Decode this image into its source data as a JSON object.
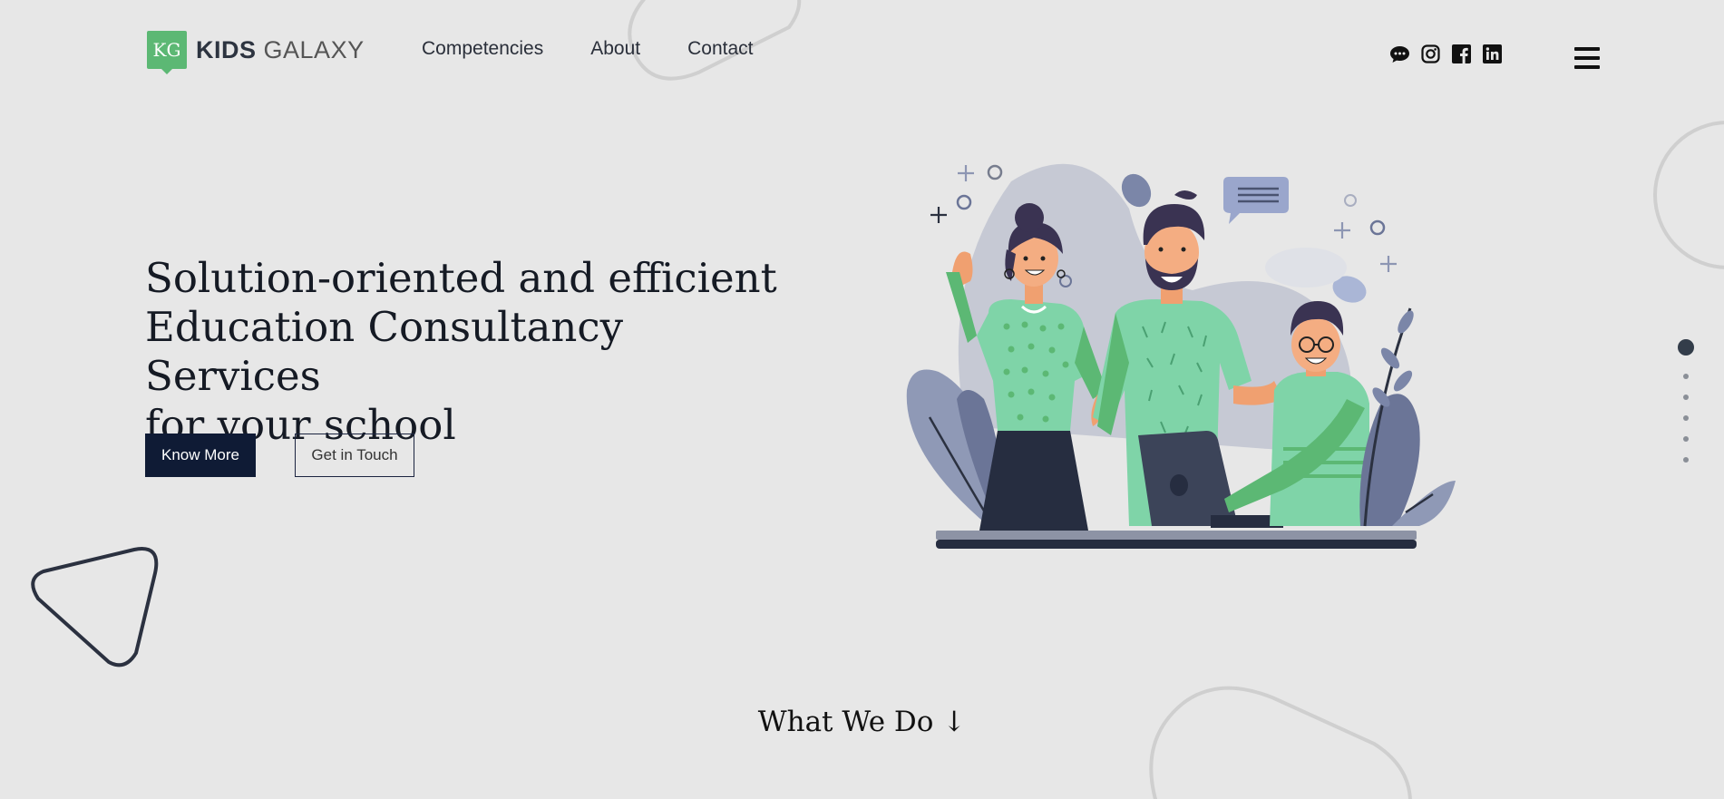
{
  "header": {
    "logo_badge": "KG",
    "logo_bold": "KIDS",
    "logo_light": "GALAXY",
    "nav": [
      {
        "label": "Competencies"
      },
      {
        "label": "About"
      },
      {
        "label": "Contact"
      }
    ],
    "socials": [
      "chat-icon",
      "instagram-icon",
      "facebook-icon",
      "linkedin-icon"
    ],
    "menu_icon": "hamburger-menu-icon"
  },
  "hero": {
    "title_lines": [
      "Solution-oriented and efficient",
      "Education Consultancy Services",
      "for your school"
    ],
    "primary_button": "Know More",
    "secondary_button": "Get in Touch"
  },
  "section_link": "What We Do ↓",
  "pagination": {
    "total": 6,
    "active": 1
  },
  "colors": {
    "background": "#e7e7e7",
    "brand_green": "#5cb874",
    "navy": "#0f1b35",
    "mint": "#7fd4a8",
    "slate": "#6b7597"
  }
}
